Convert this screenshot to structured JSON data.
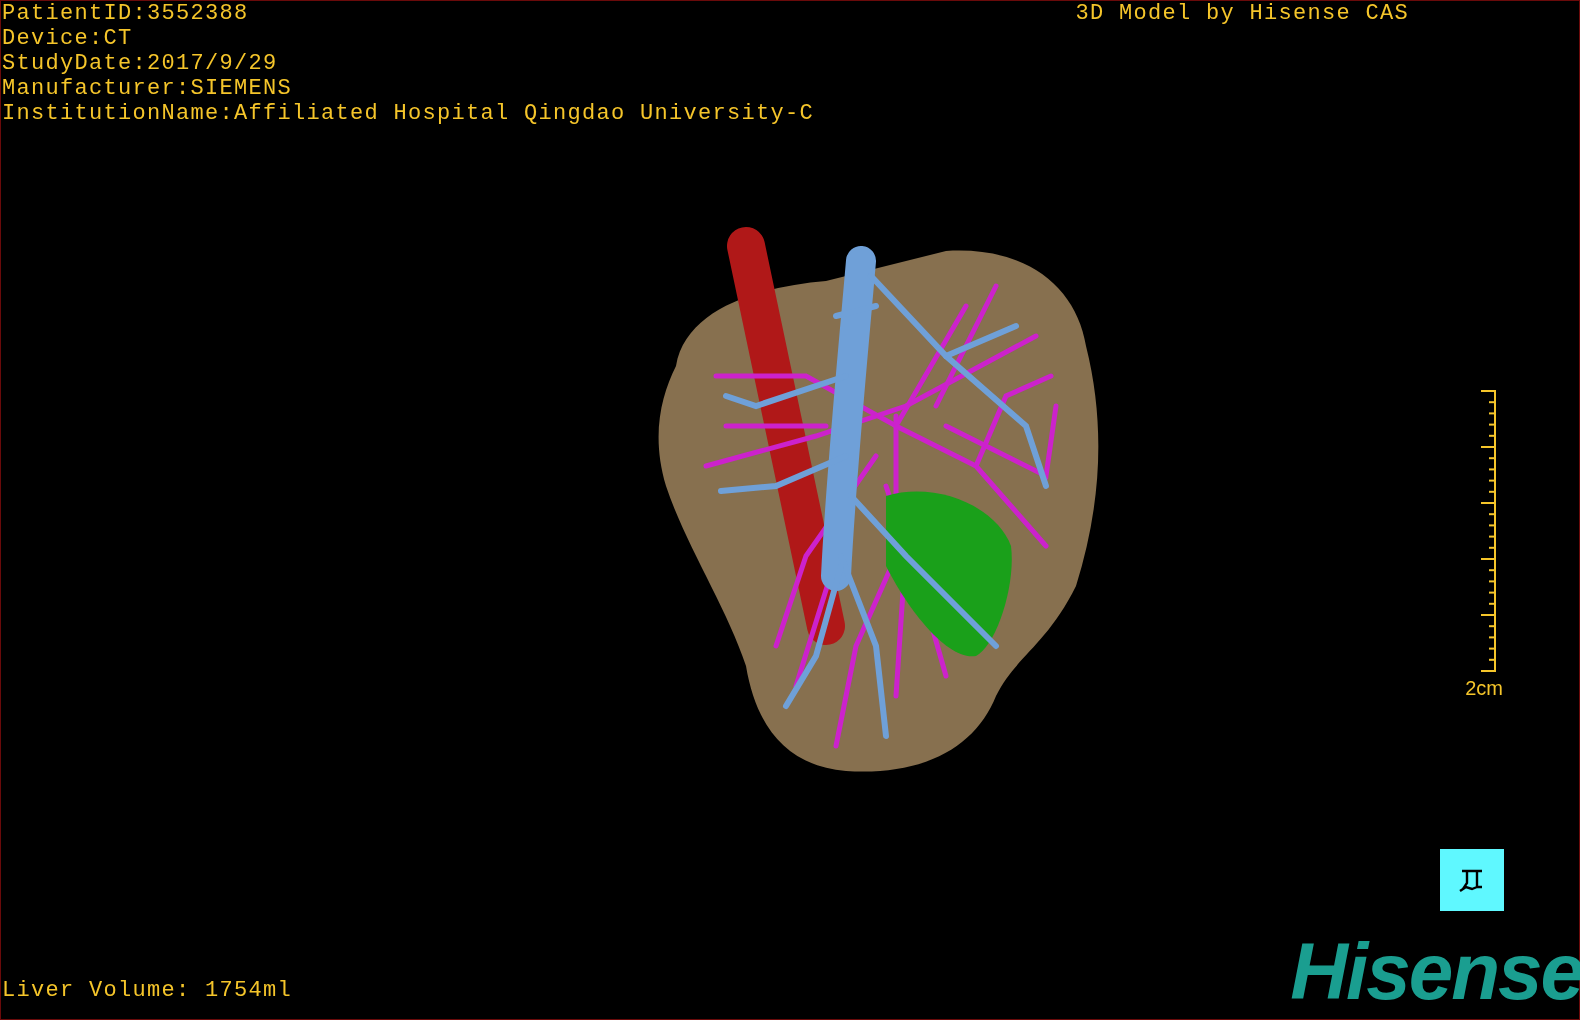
{
  "study_info": [
    "PatientID:3552388",
    "Device:CT",
    "StudyDate:2017/9/29",
    "Manufacturer:SIEMENS",
    "InstitutionName:Affiliated Hospital Qingdao University-C"
  ],
  "title": "3D Model by Hisense CAS",
  "scale_bar": {
    "label": "2cm"
  },
  "liver_volume": "Liver Volume: 1754ml",
  "logo": "Hisense"
}
